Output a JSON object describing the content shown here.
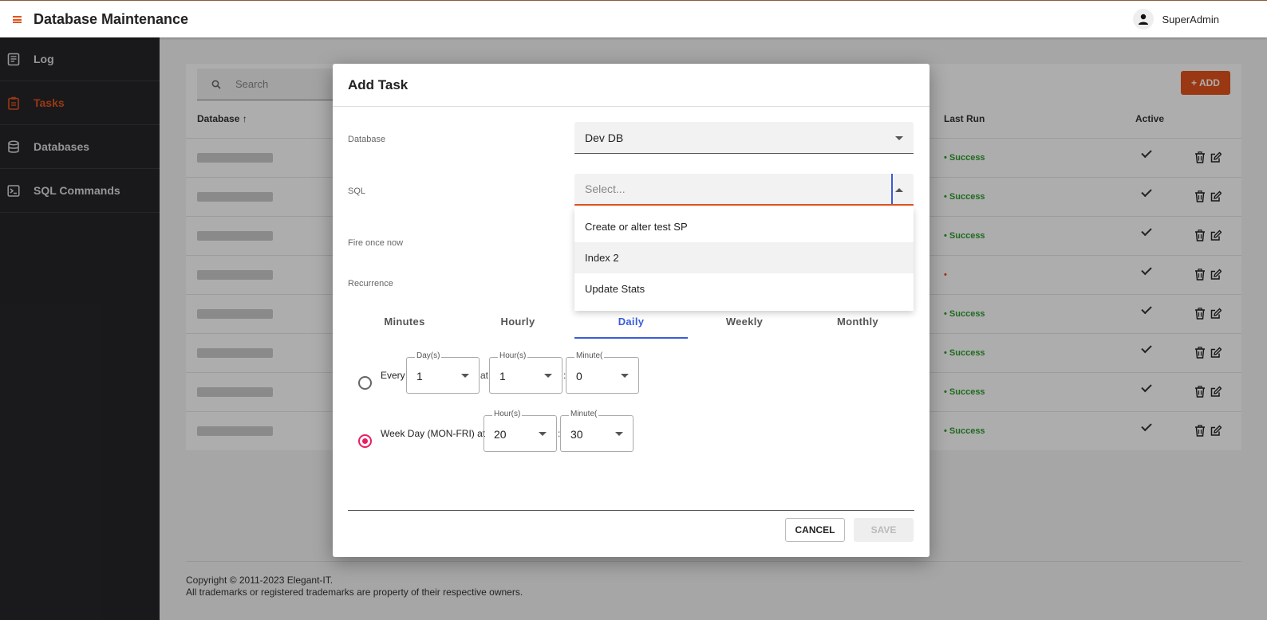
{
  "app": {
    "title": "Database Maintenance",
    "user": "SuperAdmin"
  },
  "sidebar": {
    "items": [
      {
        "label": "Log",
        "icon": "book-icon",
        "active": false
      },
      {
        "label": "Tasks",
        "icon": "clipboard-icon",
        "active": true
      },
      {
        "label": "Databases",
        "icon": "database-icon",
        "active": false
      },
      {
        "label": "SQL Commands",
        "icon": "terminal-icon",
        "active": false
      }
    ]
  },
  "tasks_page": {
    "search_placeholder": "Search",
    "add_label": "+ ADD",
    "columns": {
      "database": "Database ↑",
      "last_run": "Last Run",
      "active": "Active"
    },
    "rows": [
      {
        "last_run": "• Success",
        "active": true
      },
      {
        "last_run": "• Success",
        "active": true
      },
      {
        "last_run": "• Success",
        "active": true
      },
      {
        "last_run": "•",
        "active": true
      },
      {
        "last_run": "• Success",
        "active": true
      },
      {
        "last_run": "• Success",
        "active": true
      },
      {
        "last_run": "• Success",
        "active": true
      },
      {
        "last_run": "• Success",
        "active": true
      }
    ]
  },
  "footer": {
    "copyright": "Copyright © 2011-2023 Elegant-IT.",
    "trademarks": "All trademarks or registered trademarks are property of their respective owners."
  },
  "dialog": {
    "title": "Add Task",
    "database_label": "Database",
    "database_value": "Dev DB",
    "sql_label": "SQL",
    "sql_placeholder": "Select...",
    "sql_options": [
      "Create or alter test SP",
      "Index 2",
      "Update Stats"
    ],
    "fire_once_label": "Fire once now",
    "recurrence_label": "Recurrence",
    "tabs": [
      "Minutes",
      "Hourly",
      "Daily",
      "Weekly",
      "Monthly"
    ],
    "active_tab": "Daily",
    "option_every": {
      "label": "Every",
      "at": "at",
      "colon": ":",
      "days_legend": "Day(s)",
      "days_value": "1",
      "hours_legend": "Hour(s)",
      "hours_value": "1",
      "minutes_legend": "Minute(",
      "minutes_value": "0"
    },
    "option_weekday": {
      "label": "Week Day (MON-FRI) at",
      "colon": ":",
      "hours_legend": "Hour(s)",
      "hours_value": "20",
      "minutes_legend": "Minute(",
      "minutes_value": "30"
    },
    "cancel_label": "CANCEL",
    "save_label": "SAVE"
  },
  "colors": {
    "accent": "#e2531d",
    "success": "#2e9d2e",
    "tab_active": "#3a5bd9",
    "radio_checked": "#e91e63",
    "sidebar_bg": "#26262a"
  }
}
